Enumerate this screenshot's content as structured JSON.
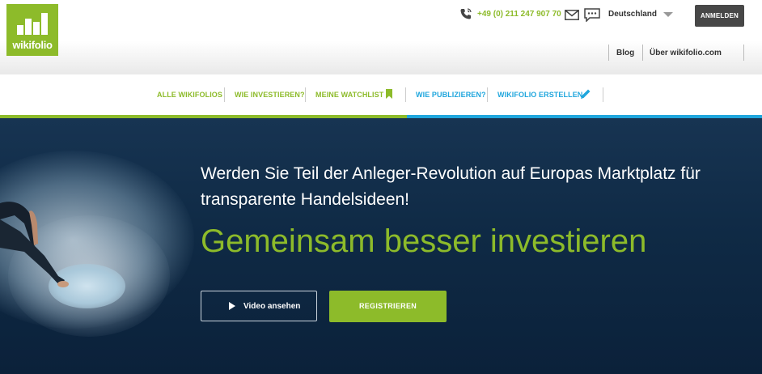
{
  "header": {
    "logo_text": "wikifolio",
    "phone": "+49 (0) 211 247 907 70",
    "country": "Deutschland",
    "login_label": "ANMELDEN",
    "links": [
      "Blog",
      "Über wikifolio.com"
    ]
  },
  "nav": {
    "items": [
      "ALLE WIKIFOLIOS",
      "WIE INVESTIEREN?",
      "MEINE WATCHLIST",
      "WIE PUBLIZIEREN?",
      "WIKIFOLIO ERSTELLEN"
    ]
  },
  "hero": {
    "headline": "Werden Sie Teil der Anleger-Revolution auf Europas Marktplatz für transparente Handelsideen!",
    "tagline": "Gemeinsam besser investieren",
    "video_label": "Video ansehen",
    "register_label": "REGISTRIEREN"
  },
  "colors": {
    "brand_green": "#8dbb2a",
    "brand_blue": "#1fa6dd",
    "hero_bg": "#0f2a45"
  },
  "icons": [
    "phone-icon",
    "mail-icon",
    "chat-icon",
    "chevron-down-icon",
    "bookmark-icon",
    "pencil-icon",
    "play-icon"
  ]
}
